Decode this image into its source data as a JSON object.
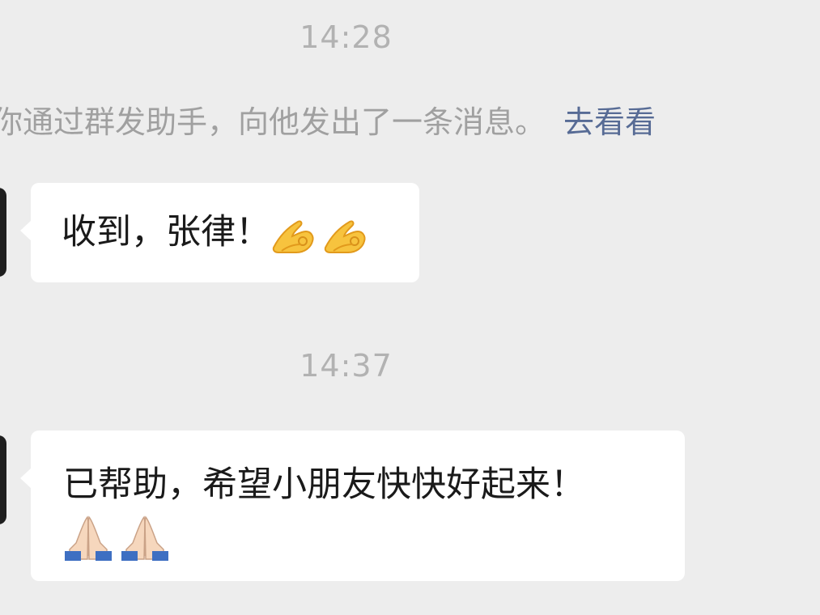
{
  "chat": {
    "time_1": "14:28",
    "system_notice": {
      "text": "你通过群发助手，向他发出了一条消息。",
      "link_text": "去看看"
    },
    "message_1": {
      "text": "收到，张律！",
      "emojis": [
        "ok-hand-icon",
        "ok-hand-icon"
      ]
    },
    "time_2": "14:37",
    "message_2": {
      "text": "已帮助，希望小朋友快快好起来！",
      "emojis": [
        "folded-hands-icon",
        "folded-hands-icon"
      ]
    }
  },
  "colors": {
    "background": "#ededed",
    "bubble": "#ffffff",
    "timestamp": "#b2b2b2",
    "system_text": "#a0a0a0",
    "link": "#576b95"
  }
}
